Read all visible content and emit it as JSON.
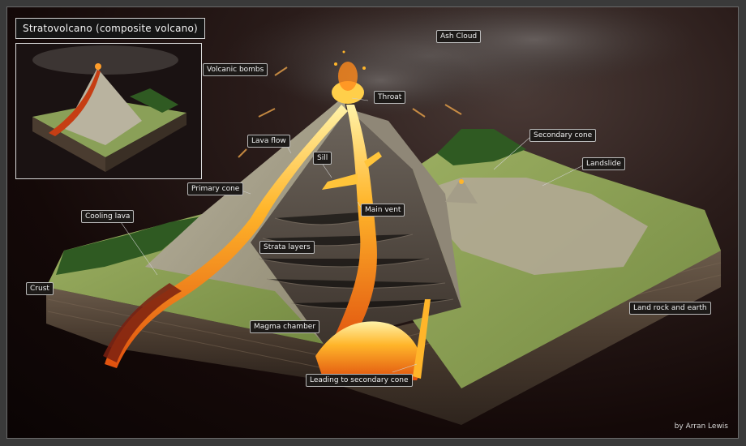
{
  "title": "Stratovolcano  (composite volcano)",
  "credit": "by Arran Lewis",
  "labels": {
    "ash_cloud": "Ash Cloud",
    "volcanic_bombs": "Volcanic bombs",
    "throat": "Throat",
    "secondary_cone": "Secondary cone",
    "lava_flow": "Lava flow",
    "sill": "Sill",
    "landslide": "Landslide",
    "primary_cone": "Primary cone",
    "main_vent": "Main vent",
    "cooling_lava": "Cooling lava",
    "strata_layers": "Strata layers",
    "crust": "Crust",
    "land_rock_and_earth": "Land rock and earth",
    "magma_chamber": "Magma chamber",
    "leading_to_secondary_cone": "Leading to secondary cone"
  },
  "colors": {
    "lava": "#ffb52a",
    "lava_dark": "#d9480f",
    "grass": "#7f9a4a",
    "rock": "#9a9486",
    "soil": "#4b3d33"
  }
}
